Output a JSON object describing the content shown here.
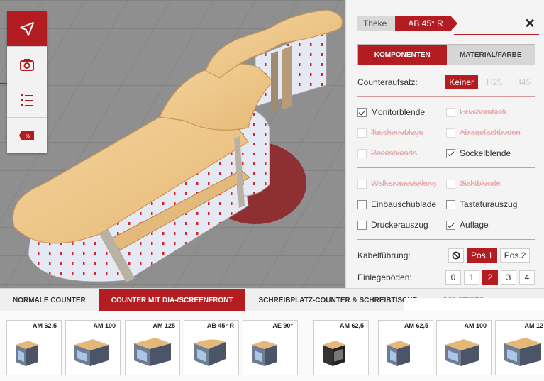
{
  "toolbar": {
    "icons": [
      "navigate-arrow-icon",
      "camera-icon",
      "list-icon",
      "price-tag-icon"
    ],
    "active_index": 0,
    "accent": "#b31d22"
  },
  "breadcrumb": {
    "parent": "Theke",
    "current": "AB 45° R"
  },
  "panel_tabs": {
    "components": "KOMPONENTEN",
    "material": "MATERIAL/FARBE",
    "active": "components"
  },
  "counter_attachment": {
    "label": "Counteraufsatz:",
    "options": [
      "Keiner",
      "H25",
      "H45"
    ],
    "selected": "Keiner"
  },
  "components_a": [
    {
      "label": "Monitorblende",
      "checked": true,
      "enabled": true
    },
    {
      "label": "Leuchtenfach",
      "checked": false,
      "enabled": false
    },
    {
      "label": "Taschenablage",
      "checked": false,
      "enabled": false
    },
    {
      "label": "Ablagefachboden",
      "checked": false,
      "enabled": false
    },
    {
      "label": "Rosenblende",
      "checked": false,
      "enabled": false
    },
    {
      "label": "Sockelblende",
      "checked": true,
      "enabled": true
    }
  ],
  "components_b": [
    {
      "label": "Wolkenausstellung",
      "checked": false,
      "enabled": false
    },
    {
      "label": "Sichtblende",
      "checked": false,
      "enabled": false
    },
    {
      "label": "Einbauschublade",
      "checked": false,
      "enabled": true
    },
    {
      "label": "Tastaturauszug",
      "checked": false,
      "enabled": true
    },
    {
      "label": "Druckerauszug",
      "checked": false,
      "enabled": true
    },
    {
      "label": "Auflage",
      "checked": true,
      "enabled": true
    }
  ],
  "cable": {
    "label": "Kabelführung:",
    "none_icon": "no-entry-icon",
    "options": [
      "Pos.1",
      "Pos.2"
    ],
    "selected": "Pos.1"
  },
  "shelves": {
    "label": "Einlegeböden:",
    "options": [
      "0",
      "1",
      "2",
      "3",
      "4"
    ],
    "selected": "2"
  },
  "category_tabs": [
    {
      "label": "NORMALE COUNTER",
      "active": false
    },
    {
      "label": "COUNTER MIT DIA-/SCREENFRONT",
      "active": true
    },
    {
      "label": "SCHREIBPLATZ-COUNTER & SCHREIBTISCHE",
      "active": false
    },
    {
      "label": "SONSTIGES",
      "active": false
    }
  ],
  "products": [
    {
      "name": "AM 62,5"
    },
    {
      "name": "AM 100"
    },
    {
      "name": "AM 125"
    },
    {
      "name": "AB 45° R"
    },
    {
      "name": "AE 90°"
    },
    {
      "name": "AM 62,5"
    },
    {
      "name": "AM 62,5"
    },
    {
      "name": "AM 100"
    },
    {
      "name": "AM 12"
    }
  ]
}
